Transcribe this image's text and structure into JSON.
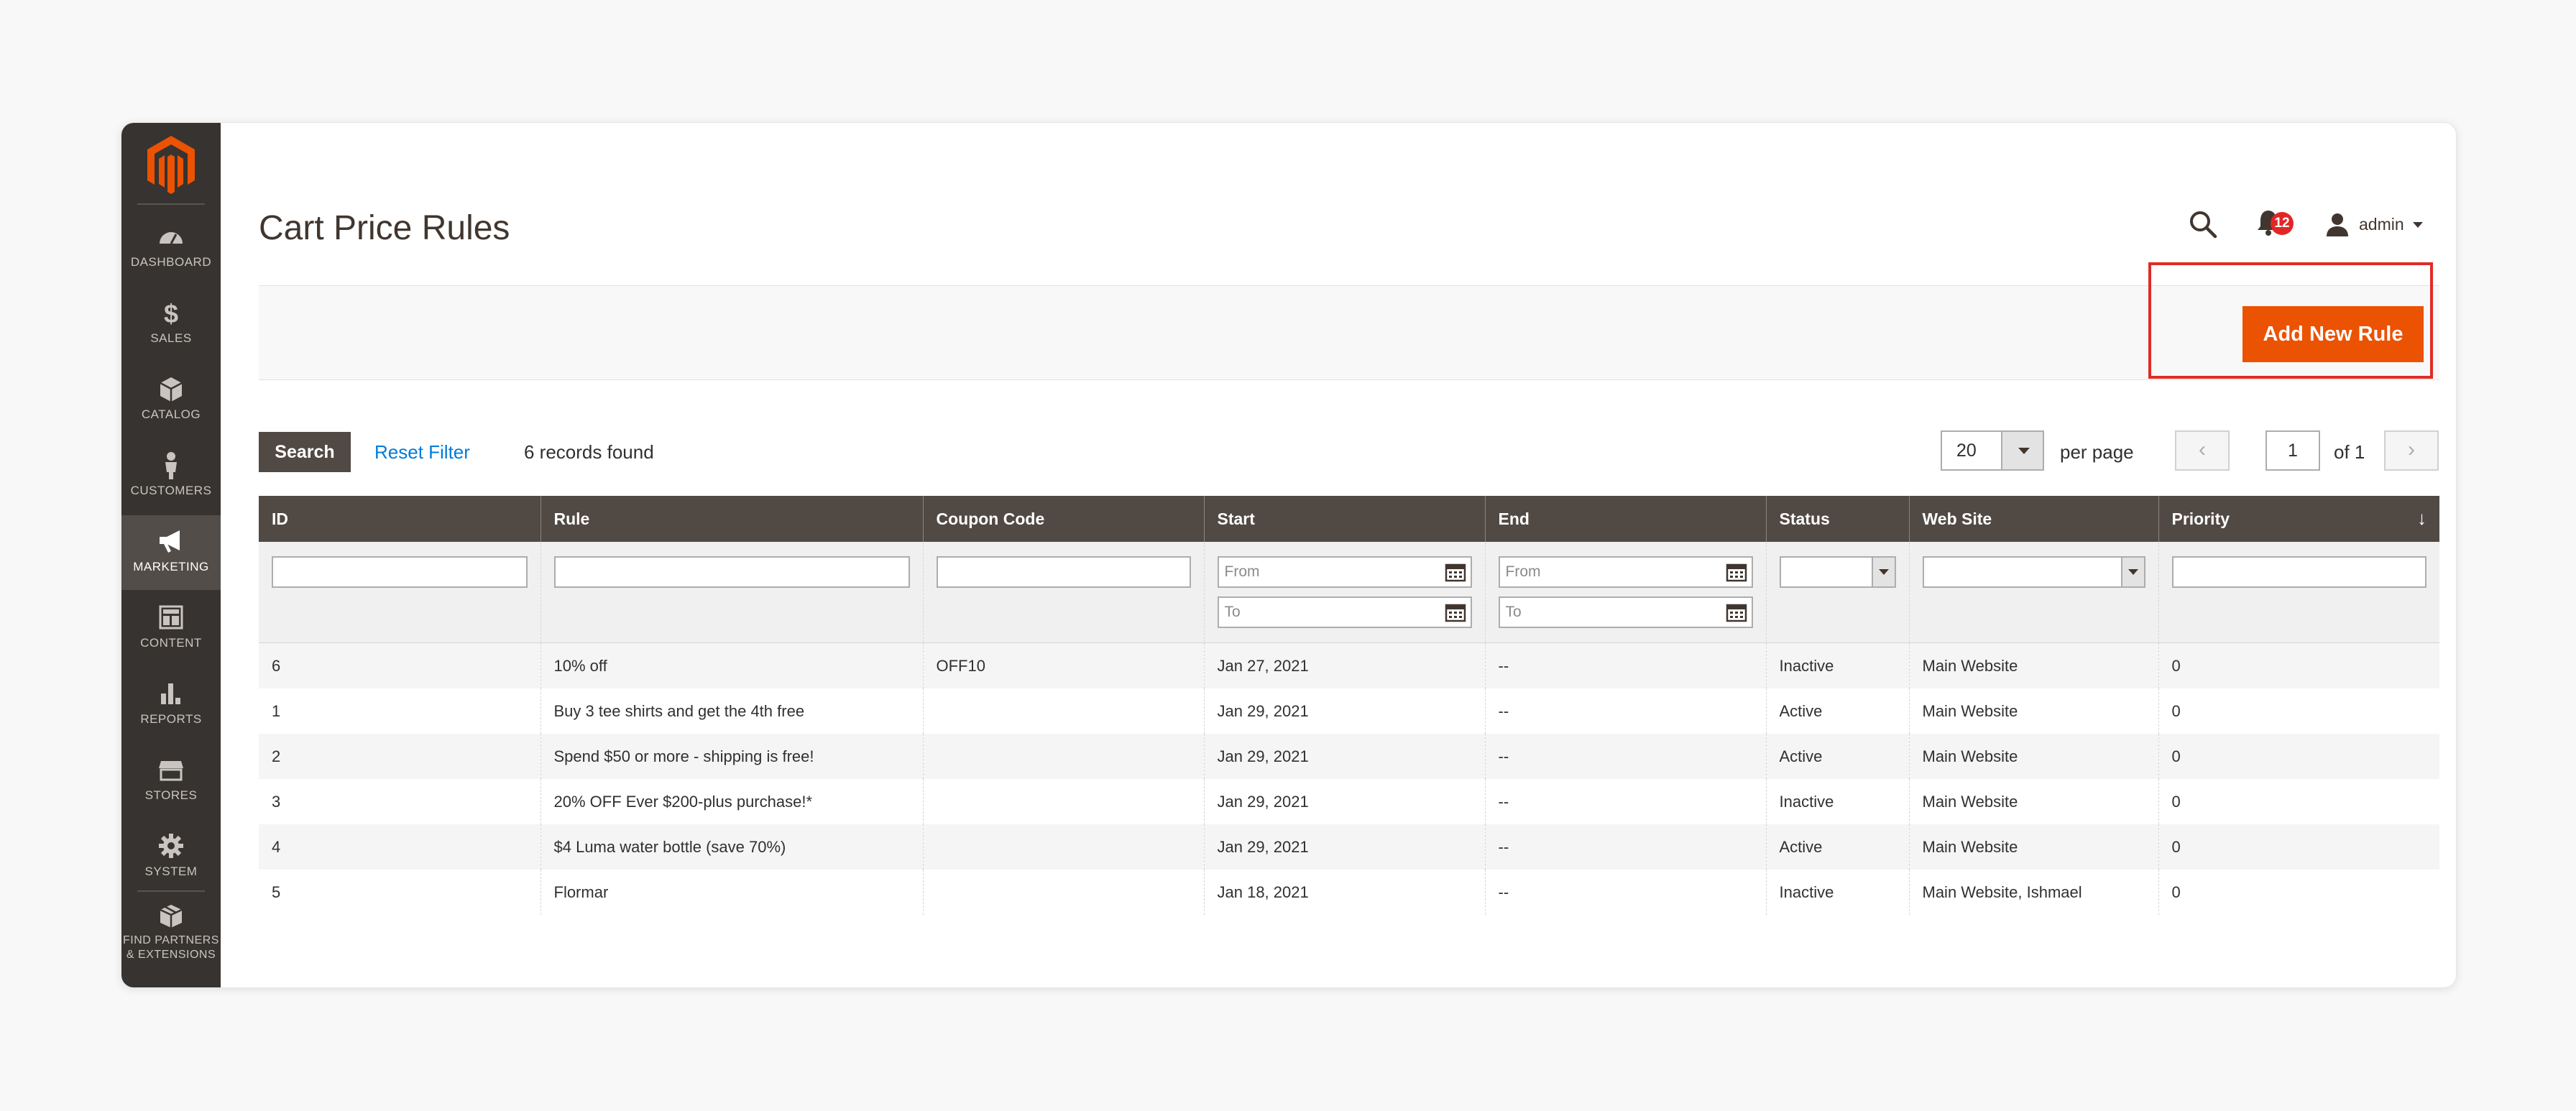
{
  "app": {
    "brand_color": "#eb5202",
    "sidebar_color": "#373330",
    "nav": [
      {
        "icon": "dashboard-icon",
        "label": "DASHBOARD"
      },
      {
        "icon": "dollar-icon",
        "label": "SALES"
      },
      {
        "icon": "cube-icon",
        "label": "CATALOG"
      },
      {
        "icon": "person-icon",
        "label": "CUSTOMERS"
      },
      {
        "icon": "megaphone-icon",
        "label": "MARKETING",
        "active": true
      },
      {
        "icon": "content-icon",
        "label": "CONTENT"
      },
      {
        "icon": "bar-chart-icon",
        "label": "REPORTS"
      },
      {
        "icon": "store-icon",
        "label": "STORES"
      },
      {
        "icon": "gear-icon",
        "label": "SYSTEM"
      },
      {
        "icon": "box-icon",
        "label_line1": "FIND PARTNERS",
        "label_line2": "& EXTENSIONS"
      }
    ]
  },
  "header": {
    "title": "Cart Price Rules",
    "notifications_count": "12",
    "username": "admin"
  },
  "actions": {
    "add_new_rule": "Add New Rule"
  },
  "toolbar": {
    "search": "Search",
    "reset_filter": "Reset Filter",
    "records_found": "6 records found",
    "per_page_value": "20",
    "per_page_label": "per page",
    "page_current": "1",
    "page_total": "of 1"
  },
  "grid": {
    "columns": [
      "ID",
      "Rule",
      "Coupon Code",
      "Start",
      "End",
      "Status",
      "Web Site",
      "Priority"
    ],
    "filter_placeholders": {
      "from": "From",
      "to": "To"
    },
    "rows": [
      [
        "6",
        "10% off",
        "OFF10",
        "Jan 27, 2021",
        "--",
        "Inactive",
        "Main Website",
        "0"
      ],
      [
        "1",
        "Buy 3 tee shirts and get the 4th free",
        "",
        "Jan 29, 2021",
        "--",
        "Active",
        "Main Website",
        "0"
      ],
      [
        "2",
        "Spend $50 or more - shipping is free!",
        "",
        "Jan 29, 2021",
        "--",
        "Active",
        "Main Website",
        "0"
      ],
      [
        "3",
        "20% OFF Ever $200-plus purchase!*",
        "",
        "Jan 29, 2021",
        "--",
        "Inactive",
        "Main Website",
        "0"
      ],
      [
        "4",
        "$4 Luma water bottle (save 70%)",
        "",
        "Jan 29, 2021",
        "--",
        "Active",
        "Main Website",
        "0"
      ],
      [
        "5",
        "Flormar",
        "",
        "Jan 18, 2021",
        "--",
        "Inactive",
        "Main Website, Ishmael",
        "0"
      ]
    ]
  }
}
